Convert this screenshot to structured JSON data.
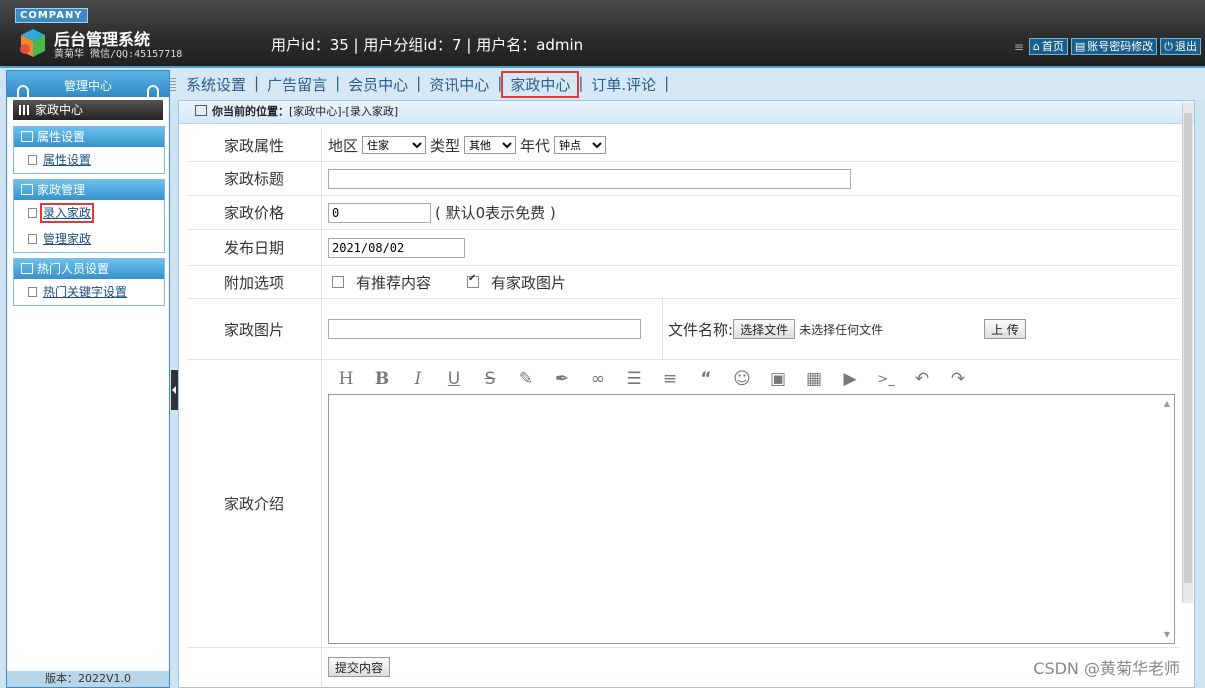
{
  "header": {
    "company_badge": "COMPANY",
    "title": "后台管理系统",
    "subtitle": "黄菊华 微信/QQ:45157718",
    "user_info": "用户id：35 | 用户分组id：7 | 用户名：admin",
    "actions": {
      "home": "首页",
      "account": "账号密码修改",
      "logout": "退出"
    }
  },
  "topnav": {
    "items": [
      "系统设置",
      "广告留言",
      "会员中心",
      "资讯中心",
      "家政中心",
      "订单.评论"
    ],
    "active": "家政中心"
  },
  "sidebar": {
    "top_title": "管理中心",
    "home": "家政中心",
    "groups": [
      {
        "title": "属性设置",
        "links": [
          "属性设置"
        ]
      },
      {
        "title": "家政管理",
        "links": [
          "录入家政",
          "管理家政"
        ]
      },
      {
        "title": "热门人员设置",
        "links": [
          "热门关键字设置"
        ]
      }
    ],
    "version": "版本：2022V1.0"
  },
  "breadcrumb": {
    "prefix": "你当前的位置：",
    "path": "[家政中心]-[录入家政]"
  },
  "form": {
    "attr_label": "家政属性",
    "region_label": "地区",
    "region_value": "住家",
    "type_label": "类型",
    "type_value": "其他",
    "era_label": "年代",
    "era_value": "钟点",
    "title_label": "家政标题",
    "title_value": "",
    "price_label": "家政价格",
    "price_value": "0",
    "price_hint": "( 默认0表示免费 )",
    "date_label": "发布日期",
    "date_value": "2021/08/02",
    "options_label": "附加选项",
    "option_recommend": "有推荐内容",
    "option_image": "有家政图片",
    "option_recommend_checked": false,
    "option_image_checked": true,
    "image_label": "家政图片",
    "image_value": "",
    "file_label": "文件名称:",
    "file_button": "选择文件",
    "file_status": "未选择任何文件",
    "upload_button": "上 传",
    "intro_label": "家政介绍",
    "submit_button": "提交内容"
  },
  "editor_toolbar": [
    "H",
    "B",
    "I",
    "U",
    "S",
    "pencil",
    "brush",
    "link",
    "list",
    "align",
    "quote",
    "emoji",
    "image",
    "table",
    "video",
    "code",
    "undo",
    "redo"
  ],
  "watermark": "CSDN @黄菊华老师",
  "colors": {
    "header_bg": "#2b2b2b",
    "accent": "#3c8cc3",
    "active_outline": "#e03a3a"
  }
}
